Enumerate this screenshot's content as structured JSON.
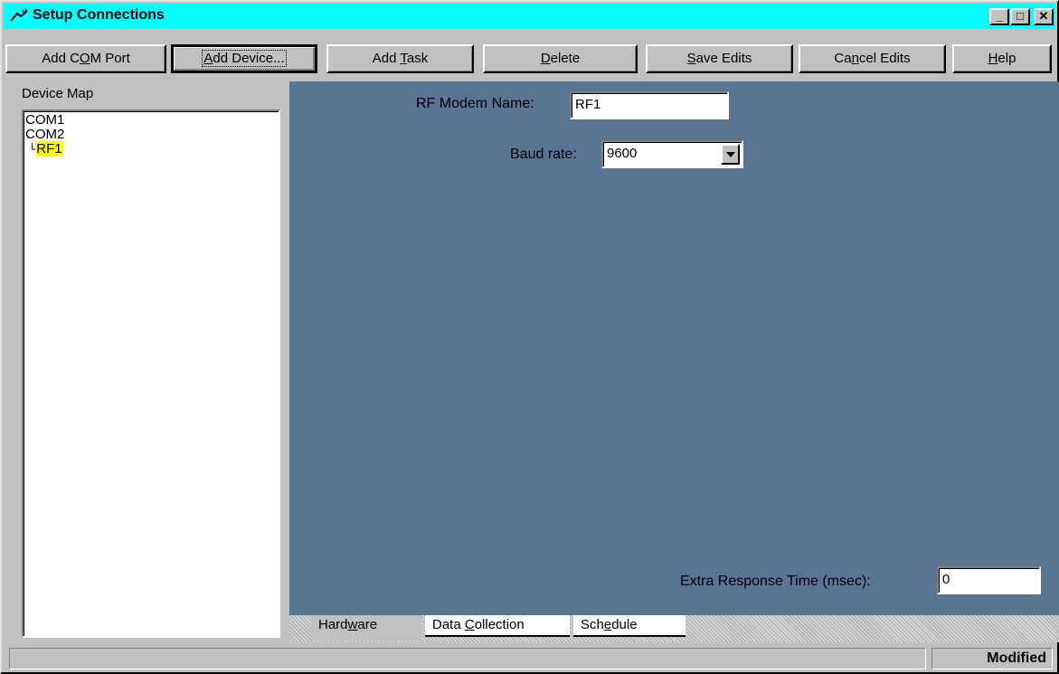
{
  "window": {
    "title": "Setup Connections"
  },
  "toolbar": {
    "add_com_port": {
      "pre": "Add C",
      "u": "O",
      "post": "M Port"
    },
    "add_device": {
      "pre": "",
      "u": "A",
      "post": "dd Device..."
    },
    "add_task": {
      "pre": "Add ",
      "u": "T",
      "post": "ask"
    },
    "delete": {
      "pre": "",
      "u": "D",
      "post": "elete"
    },
    "save_edits": {
      "pre": "",
      "u": "S",
      "post": "ave Edits"
    },
    "cancel_edits": {
      "pre": "Ca",
      "u": "n",
      "post": "cel Edits"
    },
    "help": {
      "pre": "",
      "u": "H",
      "post": "elp"
    }
  },
  "device_map": {
    "label": "Device Map",
    "items": [
      "COM1",
      "COM2",
      "RF1"
    ],
    "selected_color": "#ffff00"
  },
  "form": {
    "modem_name_label": "RF Modem Name:",
    "modem_name_value": "RF1",
    "baud_label": "Baud rate:",
    "baud_value": "9600",
    "extra_label": "Extra Response Time (msec):",
    "extra_value": "0"
  },
  "tabs": {
    "hardware": {
      "pre": "Hard",
      "u": "w",
      "post": "are"
    },
    "data_collection": {
      "pre": "Data ",
      "u": "C",
      "post": "ollection"
    },
    "schedule": {
      "pre": "Sch",
      "u": "e",
      "post": "dule"
    }
  },
  "status": {
    "text": "Modified"
  },
  "colors": {
    "panel": "#5a7494",
    "titlebar": "#00ffff"
  }
}
